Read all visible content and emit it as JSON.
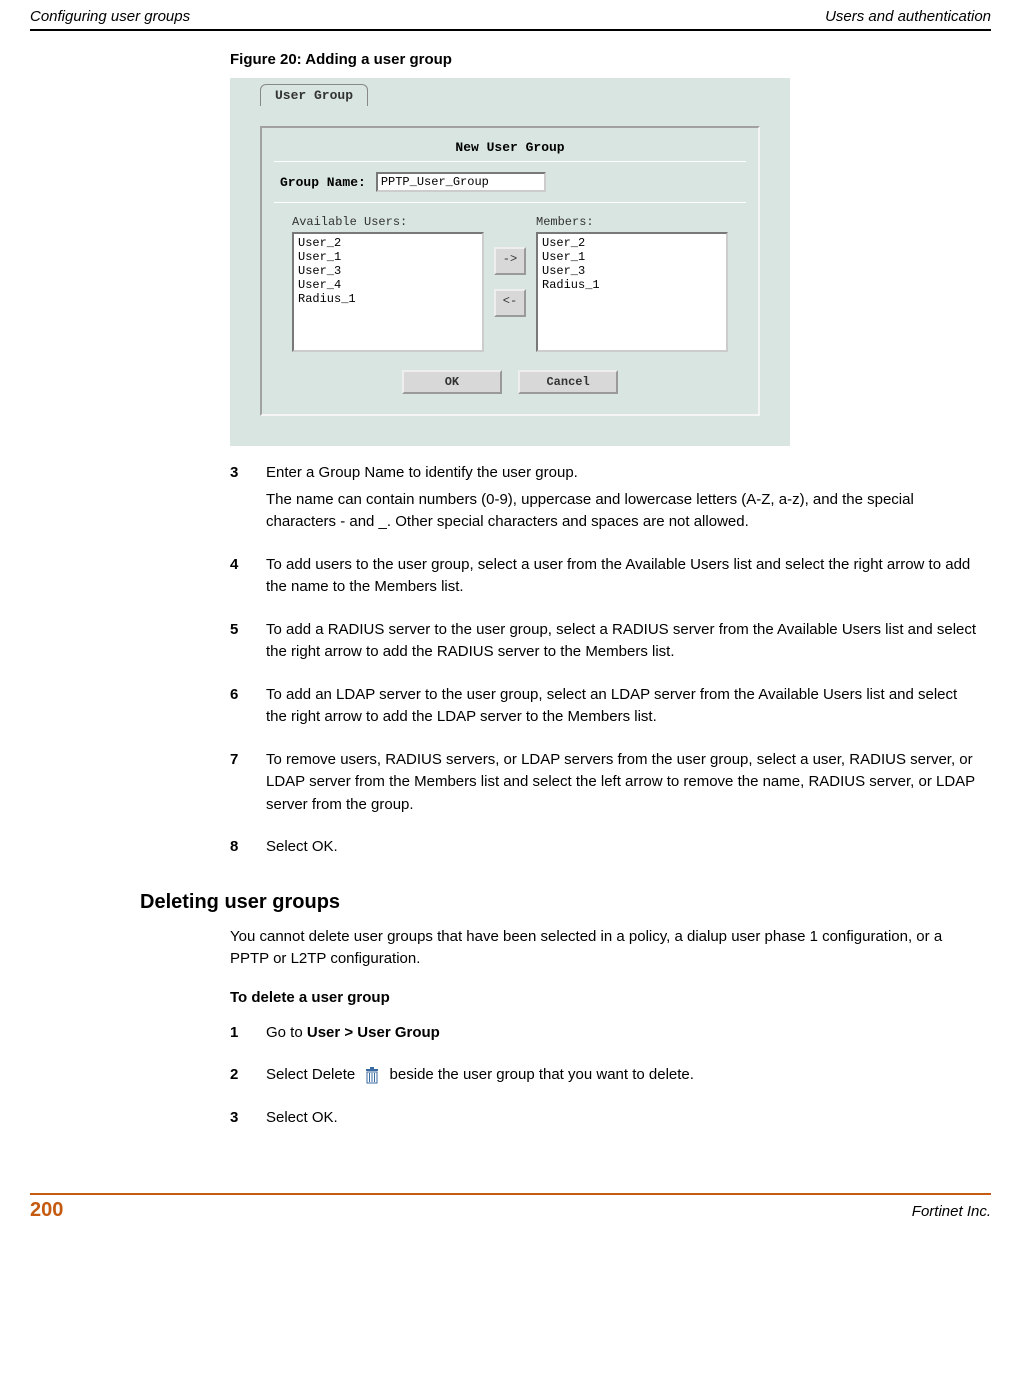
{
  "header": {
    "left": "Configuring user groups",
    "right": "Users and authentication"
  },
  "figure": {
    "caption": "Figure 20: Adding a user group",
    "tab": "User Group",
    "panel_title": "New User Group",
    "group_name_label": "Group Name:",
    "group_name_value": "PPTP_User_Group",
    "available_label": "Available Users:",
    "members_label": "Members:",
    "available_users": [
      "User_2",
      "User_1",
      "User_3",
      "User_4",
      "Radius_1"
    ],
    "members": [
      "User_2",
      "User_1",
      "User_3",
      "Radius_1"
    ],
    "arrow_right": "->",
    "arrow_left": "<-",
    "ok": "OK",
    "cancel": "Cancel"
  },
  "steps_a": [
    {
      "n": "3",
      "lines": [
        "Enter a Group Name to identify the user group.",
        "The name can contain numbers (0-9), uppercase and lowercase letters (A-Z, a-z), and the special characters - and _. Other special characters and spaces are not allowed."
      ]
    },
    {
      "n": "4",
      "lines": [
        "To add users to the user group, select a user from the Available Users list and select the right arrow to add the name to the Members list."
      ]
    },
    {
      "n": "5",
      "lines": [
        "To add a RADIUS server to the user group, select a RADIUS server from the Available Users list and select the right arrow to add the RADIUS server to the Members list."
      ]
    },
    {
      "n": "6",
      "lines": [
        "To add an LDAP server to the user group, select an LDAP server from the Available Users list and select the right arrow to add the LDAP server to the Members list."
      ]
    },
    {
      "n": "7",
      "lines": [
        "To remove users, RADIUS servers, or LDAP servers from the user group, select a user, RADIUS server, or LDAP server from the Members list and select the left arrow to remove the name, RADIUS server, or LDAP server from the group."
      ]
    },
    {
      "n": "8",
      "lines": [
        "Select OK."
      ]
    }
  ],
  "section2": {
    "heading": "Deleting user groups",
    "intro": "You cannot delete user groups that have been selected in a policy, a dialup user phase 1 configuration, or a PPTP or L2TP configuration.",
    "subhead": "To delete a user group"
  },
  "steps_b": [
    {
      "n": "1",
      "prefix": "Go to ",
      "bold": "User > User Group",
      "suffix": ""
    },
    {
      "n": "2",
      "prefix": "Select Delete ",
      "icon": true,
      "suffix": " beside the user group that you want to delete."
    },
    {
      "n": "3",
      "prefix": "Select OK.",
      "suffix": ""
    }
  ],
  "footer": {
    "page": "200",
    "company": "Fortinet Inc."
  }
}
